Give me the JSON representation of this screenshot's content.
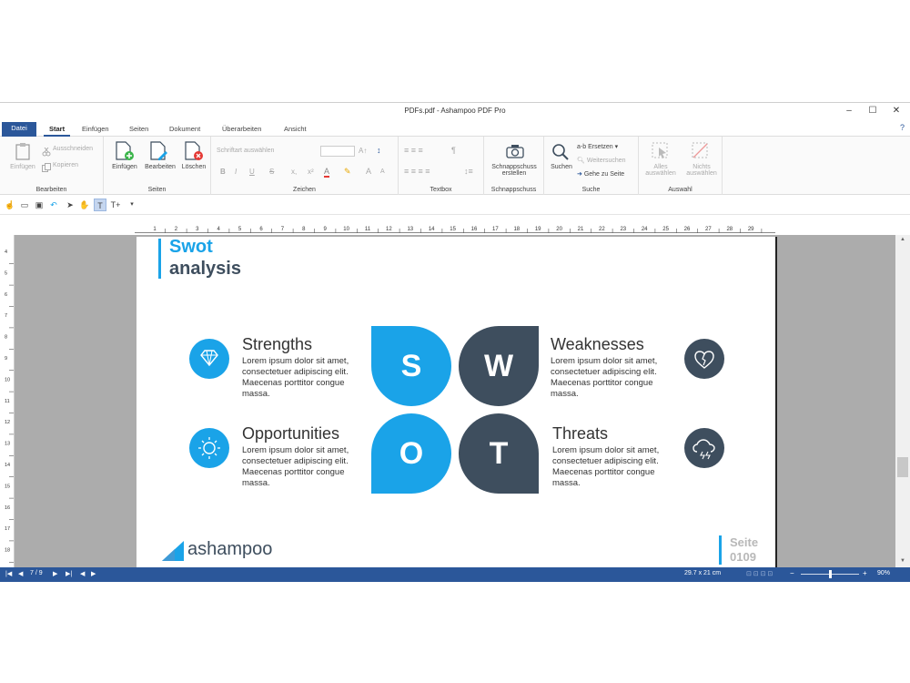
{
  "window": {
    "title": "PDFs.pdf - Ashampoo PDF Pro"
  },
  "tabs": [
    "Datei",
    "Start",
    "Einfügen",
    "Seiten",
    "Dokument",
    "Überarbeiten",
    "Ansicht"
  ],
  "help": "?",
  "ribbon": {
    "bearbeiten": {
      "group": "Bearbeiten",
      "einfuegen": "Einfügen",
      "ausschneiden": "Ausschneiden",
      "kopieren": "Kopieren"
    },
    "seiten": {
      "group": "Seiten",
      "einfuegen": "Einfügen",
      "bearbeiten": "Bearbeiten",
      "loeschen": "Löschen"
    },
    "zeichen": {
      "group": "Zeichen",
      "font_placeholder": "Schriftart auswählen",
      "bold": "B",
      "italic": "I",
      "underline": "U",
      "strike": "S",
      "sub": "x,",
      "sup": "x²",
      "color": "A",
      "size_up": "A",
      "size_down": "A"
    },
    "textbox": {
      "group": "Textbox",
      "pilcrow": "¶"
    },
    "schnappschuss": {
      "group": "Schnappschuss",
      "btn_line1": "Schnappschuss",
      "btn_line2": "erstellen"
    },
    "suche": {
      "group": "Suche",
      "suchen": "Suchen",
      "ersetzen": "Ersetzen",
      "ersetzen_prefix": "a-b",
      "weitersuchen": "Weitersuchen",
      "gehe": "Gehe zu Seite"
    },
    "auswahl": {
      "group": "Auswahl",
      "alles1": "Alles",
      "alles2": "auswählen",
      "nichts1": "Nichts",
      "nichts2": "auswählen"
    }
  },
  "ruler_numbers": [
    "1",
    "2",
    "3",
    "4",
    "5",
    "6",
    "7",
    "8",
    "9",
    "10",
    "11",
    "12",
    "13",
    "14",
    "15",
    "16",
    "17",
    "18",
    "19",
    "20",
    "21",
    "22",
    "23",
    "24",
    "25",
    "26",
    "27",
    "28",
    "29"
  ],
  "vruler_numbers": [
    "4",
    "5",
    "6",
    "7",
    "8",
    "9",
    "10",
    "11",
    "12",
    "13",
    "14",
    "15",
    "16",
    "17",
    "18"
  ],
  "page": {
    "heading1": "Swot",
    "heading2": "analysis",
    "quadrants": [
      {
        "letter": "S",
        "title": "Strengths",
        "body": "Lorem ipsum dolor sit amet, consectetuer adipiscing elit. Maecenas porttitor congue massa.",
        "icon": "diamond-icon"
      },
      {
        "letter": "W",
        "title": "Weaknesses",
        "body": "Lorem ipsum dolor sit amet, consectetuer adipiscing elit. Maecenas porttitor congue massa.",
        "icon": "broken-heart-icon"
      },
      {
        "letter": "O",
        "title": "Opportunities",
        "body": "Lorem ipsum dolor sit amet, consectetuer adipiscing elit. Maecenas porttitor congue massa.",
        "icon": "sun-icon"
      },
      {
        "letter": "T",
        "title": "Threats",
        "body": "Lorem ipsum dolor sit amet, consectetuer adipiscing elit. Maecenas porttitor congue massa.",
        "icon": "storm-cloud-icon"
      }
    ],
    "logo_text": "ashampoo",
    "footer_label": "Seite",
    "footer_number": "0109"
  },
  "colors": {
    "blue": "#1aa3e8",
    "dark": "#3e4e5e",
    "accent": "#2b579a"
  },
  "status": {
    "page": "7 / 9",
    "size": "29.7 x 21 cm",
    "zoom": "90%",
    "zoom_fraction": 0.5
  }
}
